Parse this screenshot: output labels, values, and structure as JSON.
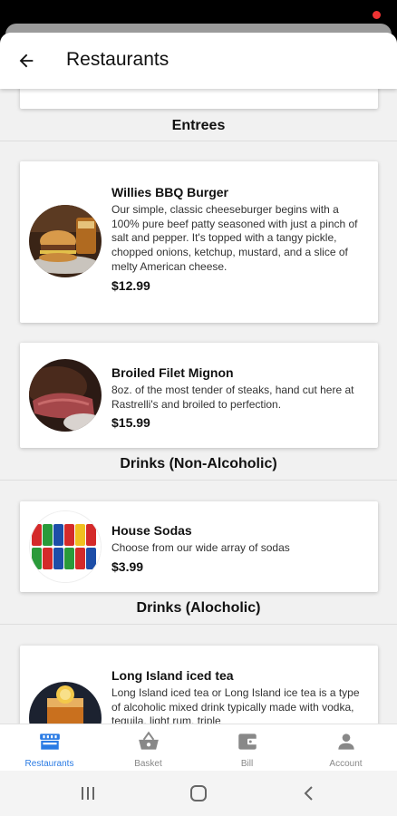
{
  "header": {
    "title": "Restaurants"
  },
  "sections": [
    {
      "title": "Entrees"
    },
    {
      "title": "Drinks (Non-Alcoholic)"
    },
    {
      "title": "Drinks (Alocholic)"
    }
  ],
  "items": [
    {
      "name": "Willies BBQ Burger",
      "description": "Our simple, classic cheeseburger begins with a 100% pure beef patty seasoned with just a pinch of salt and pepper. It's topped with a tangy pickle, chopped onions, ketchup, mustard, and a slice of melty American cheese.",
      "price": "$12.99",
      "image": "burger-photo"
    },
    {
      "name": "Broiled Filet Mignon",
      "description": " 8oz. of the most tender of steaks, hand cut here at Rastrelli's and broiled to perfection.",
      "price": "$15.99",
      "image": "steak-photo"
    },
    {
      "name": "House Sodas",
      "description": "Choose from our wide array of sodas",
      "price": "$3.99",
      "image": "soda-cans-photo"
    },
    {
      "name": "Long Island iced tea",
      "description": " Long Island iced tea or Long Island ice tea is a type of alcoholic mixed drink typically made with vodka, tequila, light rum, triple",
      "price": "",
      "image": "iced-tea-photo"
    }
  ],
  "bottom_nav": [
    {
      "label": "Restaurants",
      "icon": "storefront-icon",
      "active": true
    },
    {
      "label": "Basket",
      "icon": "basket-icon",
      "active": false
    },
    {
      "label": "Bill",
      "icon": "wallet-icon",
      "active": false
    },
    {
      "label": "Account",
      "icon": "person-icon",
      "active": false
    }
  ],
  "colors": {
    "accent": "#2a7be4",
    "background": "#f1f1f1",
    "card": "#ffffff"
  }
}
